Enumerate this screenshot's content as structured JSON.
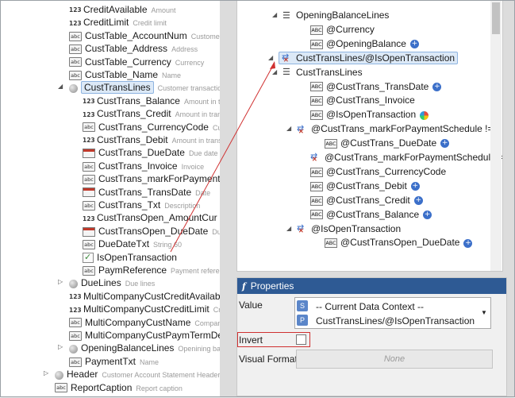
{
  "left_tree": [
    {
      "name": "CreditAvailable",
      "desc": "Amount",
      "icon": "num",
      "indent": 1
    },
    {
      "name": "CreditLimit",
      "desc": "Credit limit",
      "icon": "num",
      "indent": 1
    },
    {
      "name": "CustTable_AccountNum",
      "desc": "Customer acco",
      "icon": "abc",
      "indent": 1
    },
    {
      "name": "CustTable_Address",
      "desc": "Address",
      "icon": "abc",
      "indent": 1
    },
    {
      "name": "CustTable_Currency",
      "desc": "Currency",
      "icon": "abc",
      "indent": 1
    },
    {
      "name": "CustTable_Name",
      "desc": "Name",
      "icon": "abc",
      "indent": 1
    },
    {
      "name": "CustTransLines",
      "desc": "Customer transactions",
      "icon": "circle",
      "indent": 1,
      "expanded": true,
      "selected": true
    },
    {
      "name": "CustTrans_Balance",
      "desc": "Amount in transac",
      "icon": "num",
      "indent": 2
    },
    {
      "name": "CustTrans_Credit",
      "desc": "Amount in transac",
      "icon": "num",
      "indent": 2
    },
    {
      "name": "CustTrans_CurrencyCode",
      "desc": "Currency",
      "icon": "abc",
      "indent": 2
    },
    {
      "name": "CustTrans_Debit",
      "desc": "Amount in transac",
      "icon": "num",
      "indent": 2
    },
    {
      "name": "CustTrans_DueDate",
      "desc": "Due date",
      "icon": "date",
      "indent": 2
    },
    {
      "name": "CustTrans_Invoice",
      "desc": "Invoice",
      "icon": "abc",
      "indent": 2
    },
    {
      "name": "CustTrans_markForPaymentSche",
      "desc": "",
      "icon": "abc",
      "indent": 2
    },
    {
      "name": "CustTrans_TransDate",
      "desc": "Date",
      "icon": "date",
      "indent": 2
    },
    {
      "name": "CustTrans_Txt",
      "desc": "Description",
      "icon": "abc",
      "indent": 2
    },
    {
      "name": "CustTransOpen_AmountCur",
      "desc": "Amou",
      "icon": "num",
      "indent": 2
    },
    {
      "name": "CustTransOpen_DueDate",
      "desc": "Due date",
      "icon": "date",
      "indent": 2
    },
    {
      "name": "DueDateTxt",
      "desc": "String 60",
      "icon": "abc",
      "indent": 2
    },
    {
      "name": "IsOpenTransaction",
      "desc": "",
      "icon": "check",
      "indent": 2
    },
    {
      "name": "PaymReference",
      "desc": "Payment reference",
      "icon": "abc",
      "indent": 2
    },
    {
      "name": "DueLines",
      "desc": "Due lines",
      "icon": "circle",
      "indent": 1,
      "collapsed": true
    },
    {
      "name": "MultiCompanyCustCreditAvailable",
      "desc": "C",
      "icon": "num",
      "indent": 1
    },
    {
      "name": "MultiCompanyCustCreditLimit",
      "desc": "Credit",
      "icon": "num",
      "indent": 1
    },
    {
      "name": "MultiCompanyCustName",
      "desc": "Company nam",
      "icon": "abc",
      "indent": 1
    },
    {
      "name": "MultiCompanyCustPaymTermDesc",
      "desc": "D",
      "icon": "abc",
      "indent": 1
    },
    {
      "name": "OpeningBalanceLines",
      "desc": "Openining balance",
      "icon": "circle",
      "indent": 1,
      "collapsed": true
    },
    {
      "name": "PaymentTxt",
      "desc": "Name",
      "icon": "abc",
      "indent": 1
    },
    {
      "name": "Header",
      "desc": "Customer Account Statement Header",
      "icon": "circle",
      "indent": 0,
      "collapsed": true
    },
    {
      "name": "ReportCaption",
      "desc": "Report caption",
      "icon": "abc",
      "indent": 0
    }
  ],
  "right_tree": [
    {
      "text": "OpeningBalanceLines",
      "icon": "enum",
      "indent": 0,
      "arrow": "expanded"
    },
    {
      "text": "@Currency",
      "icon": "abc",
      "indent": 1
    },
    {
      "text": "@OpeningBalance",
      "icon": "abc",
      "indent": 1,
      "badge": "plus"
    },
    {
      "text": "CustTransLines/@IsOpenTransaction",
      "icon": "cond",
      "indent": -1,
      "arrow": "expanded",
      "selected": true
    },
    {
      "text": "CustTransLines",
      "icon": "enum",
      "indent": 0,
      "arrow": "expanded"
    },
    {
      "text": "@CustTrans_TransDate",
      "icon": "abc",
      "indent": 1,
      "badge": "plus"
    },
    {
      "text": "@CustTrans_Invoice",
      "icon": "abc",
      "indent": 1
    },
    {
      "text": "@IsOpenTransaction",
      "icon": "abc",
      "indent": 1,
      "badge": "multi"
    },
    {
      "text": "@CustTrans_markForPaymentSchedule != ''",
      "icon": "cond",
      "indent": 0.7,
      "arrow": "expanded"
    },
    {
      "text": "@CustTrans_DueDate",
      "icon": "abc",
      "indent": 2,
      "badge": "plus"
    },
    {
      "text": "@CustTrans_markForPaymentSchedule != ''",
      "icon": "cond",
      "indent": 1
    },
    {
      "text": "@CustTrans_CurrencyCode",
      "icon": "abc",
      "indent": 1
    },
    {
      "text": "@CustTrans_Debit",
      "icon": "abc",
      "indent": 1,
      "badge": "plus"
    },
    {
      "text": "@CustTrans_Credit",
      "icon": "abc",
      "indent": 1,
      "badge": "plus"
    },
    {
      "text": "@CustTrans_Balance",
      "icon": "abc",
      "indent": 1,
      "badge": "plus"
    },
    {
      "text": "@IsOpenTransaction",
      "icon": "cond",
      "indent": 0.7,
      "arrow": "expanded"
    },
    {
      "text": "@CustTransOpen_DueDate",
      "icon": "abc",
      "indent": 2,
      "badge": "plus"
    }
  ],
  "properties": {
    "title": "Properties",
    "title_icon": "f",
    "value_label": "Value",
    "value_line1": "-- Current Data Context --",
    "value_line2": "CustTransLines/@IsOpenTransaction",
    "badge_s": "S",
    "badge_p": "P",
    "invert_label": "Invert",
    "invert_checked": false,
    "visual_format_label": "Visual Format",
    "visual_format_value": "None"
  },
  "colors": {
    "header_bg": "#2e5a94",
    "selection_bg": "#dce9f7",
    "annotation_red": "#d03030"
  }
}
